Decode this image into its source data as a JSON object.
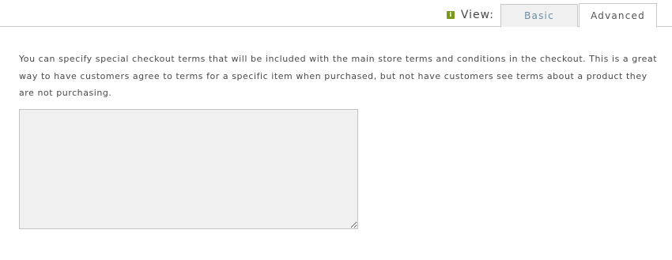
{
  "view_switcher": {
    "label": "View:",
    "info_icon": "info-icon",
    "tabs": [
      {
        "label": "Basic",
        "active": false
      },
      {
        "label": "Advanced",
        "active": true
      }
    ]
  },
  "checkout_terms": {
    "description": "You can specify special checkout terms that will be included with the main store terms and conditions in the checkout. This is a great way to have customers agree to terms for a specific item when purchased, but not have customers see terms about a product they are not purchasing.",
    "value": ""
  },
  "colors": {
    "accent_icon": "#7a9a1f",
    "basic_tab_text": "#6b8fa0",
    "textarea_bg": "#f0f0f0"
  }
}
